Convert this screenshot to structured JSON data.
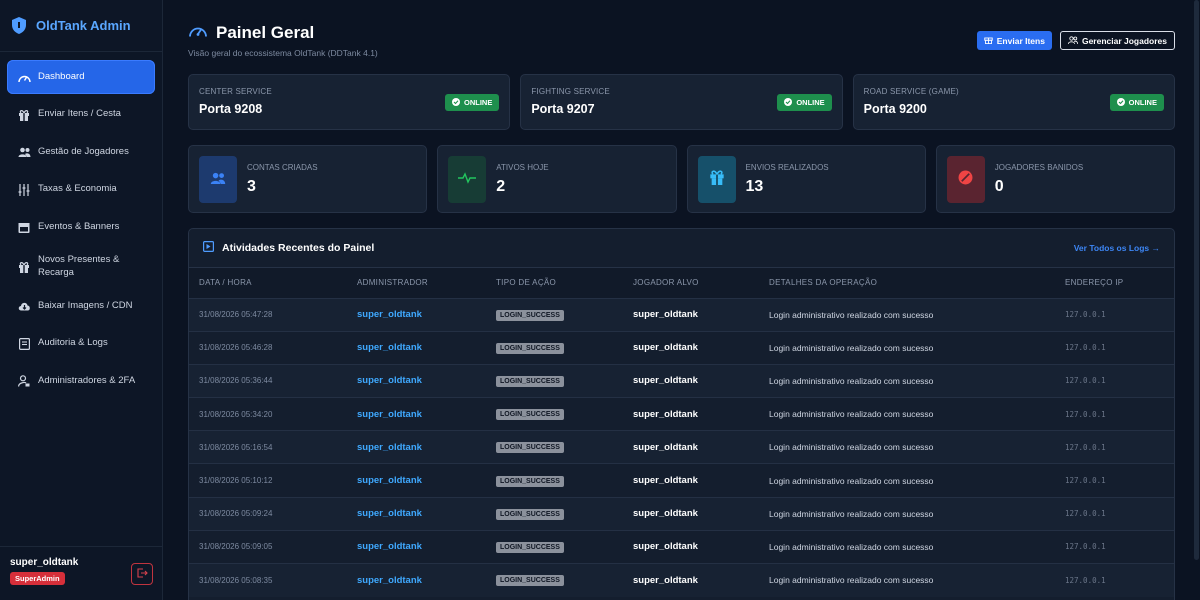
{
  "app": {
    "title": "OldTank Admin"
  },
  "sidebar": {
    "items": [
      {
        "label": "Dashboard",
        "icon": "dashboard-gauge-icon"
      },
      {
        "label": "Enviar Itens / Cesta",
        "icon": "gift-icon"
      },
      {
        "label": "Gestão de Jogadores",
        "icon": "users-icon"
      },
      {
        "label": "Taxas & Economia",
        "icon": "sliders-icon"
      },
      {
        "label": "Eventos & Banners",
        "icon": "calendar-icon"
      },
      {
        "label": "Novos Presentes & Recarga",
        "icon": "gift-icon"
      },
      {
        "label": "Baixar Imagens / CDN",
        "icon": "cloud-download-icon"
      },
      {
        "label": "Auditoria & Logs",
        "icon": "journal-icon"
      },
      {
        "label": "Administradores & 2FA",
        "icon": "user-lock-icon"
      }
    ],
    "user": {
      "name": "super_oldtank",
      "role": "SuperAdmin"
    }
  },
  "header": {
    "title": "Painel Geral",
    "subtitle": "Visão geral do ecossistema OldTank (DDTank 4.1)",
    "send_items_label": "Enviar Itens",
    "manage_players_label": "Gerenciar Jogadores"
  },
  "services": [
    {
      "name": "CENTER SERVICE",
      "port": "Porta 9208",
      "status": "ONLINE"
    },
    {
      "name": "FIGHTING SERVICE",
      "port": "Porta 9207",
      "status": "ONLINE"
    },
    {
      "name": "ROAD SERVICE (GAME)",
      "port": "Porta 9200",
      "status": "ONLINE"
    }
  ],
  "stats": [
    {
      "label": "CONTAS CRIADAS",
      "value": "3",
      "color": "#3b82f6"
    },
    {
      "label": "ATIVOS HOJE",
      "value": "2",
      "color": "#22c55e"
    },
    {
      "label": "ENVIOS REALIZADOS",
      "value": "13",
      "color": "#38bdf8"
    },
    {
      "label": "JOGADORES BANIDOS",
      "value": "0",
      "color": "#ef4444"
    }
  ],
  "activity": {
    "title": "Atividades Recentes do Painel",
    "view_all": "Ver Todos os Logs →",
    "columns": [
      "DATA / HORA",
      "ADMINISTRADOR",
      "TIPO DE AÇÃO",
      "JOGADOR ALVO",
      "DETALHES DA OPERAÇÃO",
      "ENDEREÇO IP"
    ],
    "rows": [
      {
        "date": "31/08/2026 05:47:28",
        "admin": "super_oldtank",
        "action": "LOGIN_SUCCESS",
        "target": "super_oldtank",
        "details": "Login administrativo realizado com sucesso",
        "ip": "127.0.0.1"
      },
      {
        "date": "31/08/2026 05:46:28",
        "admin": "super_oldtank",
        "action": "LOGIN_SUCCESS",
        "target": "super_oldtank",
        "details": "Login administrativo realizado com sucesso",
        "ip": "127.0.0.1"
      },
      {
        "date": "31/08/2026 05:36:44",
        "admin": "super_oldtank",
        "action": "LOGIN_SUCCESS",
        "target": "super_oldtank",
        "details": "Login administrativo realizado com sucesso",
        "ip": "127.0.0.1"
      },
      {
        "date": "31/08/2026 05:34:20",
        "admin": "super_oldtank",
        "action": "LOGIN_SUCCESS",
        "target": "super_oldtank",
        "details": "Login administrativo realizado com sucesso",
        "ip": "127.0.0.1"
      },
      {
        "date": "31/08/2026 05:16:54",
        "admin": "super_oldtank",
        "action": "LOGIN_SUCCESS",
        "target": "super_oldtank",
        "details": "Login administrativo realizado com sucesso",
        "ip": "127.0.0.1"
      },
      {
        "date": "31/08/2026 05:10:12",
        "admin": "super_oldtank",
        "action": "LOGIN_SUCCESS",
        "target": "super_oldtank",
        "details": "Login administrativo realizado com sucesso",
        "ip": "127.0.0.1"
      },
      {
        "date": "31/08/2026 05:09:24",
        "admin": "super_oldtank",
        "action": "LOGIN_SUCCESS",
        "target": "super_oldtank",
        "details": "Login administrativo realizado com sucesso",
        "ip": "127.0.0.1"
      },
      {
        "date": "31/08/2026 05:09:05",
        "admin": "super_oldtank",
        "action": "LOGIN_SUCCESS",
        "target": "super_oldtank",
        "details": "Login administrativo realizado com sucesso",
        "ip": "127.0.0.1"
      },
      {
        "date": "31/08/2026 05:08:35",
        "admin": "super_oldtank",
        "action": "LOGIN_SUCCESS",
        "target": "super_oldtank",
        "details": "Login administrativo realizado com sucesso",
        "ip": "127.0.0.1"
      }
    ]
  }
}
